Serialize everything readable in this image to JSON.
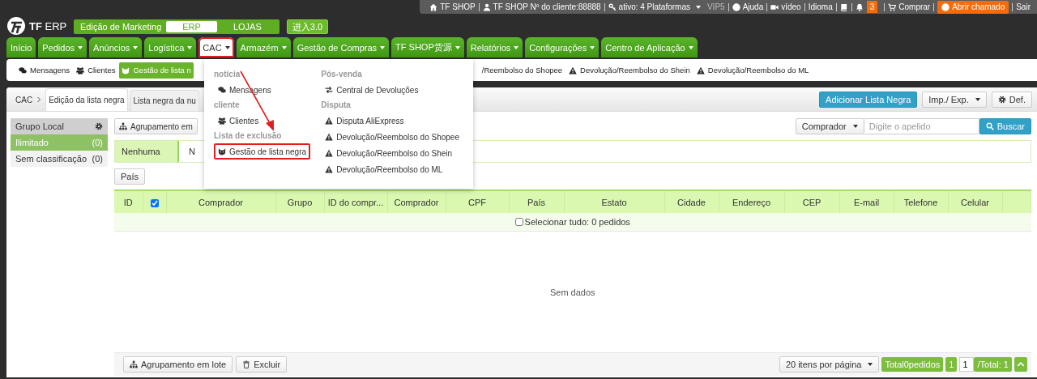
{
  "top_bar": {
    "shop": "TF SHOP",
    "client": "TF SHOP Nº do cliente:88888",
    "platforms": "ativo: 4 Plataformas",
    "vip": "VIP5",
    "help": "Ajuda",
    "video": "vídeo",
    "language": "Idioma",
    "notifications": "3",
    "buy": "Comprar",
    "ticket": "Abrir chamado",
    "logout": "Sair"
  },
  "logo": "**TF** ERP",
  "edition": {
    "label": "Edição de Marketing",
    "options": [
      {
        "label": "ERP",
        "selected": true
      },
      {
        "label": "LOJAS",
        "selected": false
      }
    ]
  },
  "version_button": "进入3.0",
  "nav": [
    {
      "label": "Início",
      "dropdown": false,
      "selected": false,
      "highlighted": false
    },
    {
      "label": "Pedidos",
      "dropdown": true,
      "selected": false,
      "highlighted": false
    },
    {
      "label": "Anúncios",
      "dropdown": true,
      "selected": false,
      "highlighted": false
    },
    {
      "label": "Logística",
      "dropdown": true,
      "selected": false,
      "highlighted": false
    },
    {
      "label": "CAC",
      "dropdown": true,
      "selected": true,
      "highlighted": true
    },
    {
      "label": "Armazém",
      "dropdown": true,
      "selected": false,
      "highlighted": false
    },
    {
      "label": "Gestão de Compras",
      "dropdown": true,
      "selected": false,
      "highlighted": false
    },
    {
      "label": "TF SHOP货源",
      "dropdown": true,
      "selected": false,
      "highlighted": false
    },
    {
      "label": "Relatórios",
      "dropdown": true,
      "selected": false,
      "highlighted": false
    },
    {
      "label": "Configurações",
      "dropdown": true,
      "selected": false,
      "highlighted": false
    },
    {
      "label": "Centro de Aplicação",
      "dropdown": true,
      "selected": false,
      "highlighted": false
    }
  ],
  "submenu": [
    {
      "label": "Mensagens",
      "selected": false
    },
    {
      "label": "Clientes",
      "selected": false
    },
    {
      "label": "Gestão de lista n",
      "selected": true
    },
    {
      "label": "/Reembolso do Shopee",
      "selected": false
    },
    {
      "label": "Devolução/Reembolso do Shein",
      "selected": false
    },
    {
      "label": "Devolução/Reembolso do ML",
      "selected": false
    }
  ],
  "dropdown": {
    "columns": [
      {
        "groups": [
          {
            "title": "notícia",
            "items": [
              {
                "label": "Mensagens",
                "highlighted": false
              }
            ]
          },
          {
            "title": "cliente",
            "items": [
              {
                "label": "Clientes",
                "highlighted": false
              }
            ]
          },
          {
            "title": "Lista de exclusão",
            "items": [
              {
                "label": "Gestão de lista negra",
                "highlighted": true
              }
            ]
          }
        ]
      },
      {
        "groups": [
          {
            "title": "Pós-venda",
            "items": [
              {
                "label": "Central de Devoluções",
                "highlighted": false
              }
            ]
          },
          {
            "title": "Disputa",
            "items": [
              {
                "label": "Disputa AliExpress",
                "highlighted": false
              },
              {
                "label": "Devolução/Reembolso do Shopee",
                "highlighted": false
              },
              {
                "label": "Devolução/Reembolso do Shein",
                "highlighted": false
              },
              {
                "label": "Devolução/Reembolso do ML",
                "highlighted": false
              }
            ]
          }
        ]
      }
    ]
  },
  "breadcrumb": "CAC",
  "tabs": [
    {
      "label": "Edição da lista negra",
      "selected": true
    },
    {
      "label": "Lista negra da nu",
      "selected": false
    }
  ],
  "actions": {
    "add": "Adicionar Lista Negra",
    "import_export": "Imp./ Exp.",
    "settings": "Def."
  },
  "sidebar": {
    "title": "Grupo Local",
    "items": [
      {
        "label": "Ilimitado",
        "count": "(0)",
        "selected": true
      },
      {
        "label": "Sem classificação",
        "count": "(0)",
        "selected": false
      }
    ]
  },
  "toolbar": {
    "group_button": "Agrupamento em",
    "search": {
      "field": "Comprador",
      "placeholder": "Digite o apelido",
      "button": "Buscar"
    }
  },
  "filter": {
    "options": [
      {
        "label": "Nenhuma",
        "selected": true
      },
      {
        "label": "N",
        "selected": false
      }
    ],
    "country_button": "País"
  },
  "table": {
    "columns": [
      {
        "kind": "text",
        "label": "ID"
      },
      {
        "kind": "checkbox",
        "checked": true
      },
      {
        "kind": "text",
        "label": "Comprador"
      },
      {
        "kind": "text",
        "label": "Grupo"
      },
      {
        "kind": "text",
        "label": "ID do compr..."
      },
      {
        "kind": "text",
        "label": "Comprador"
      },
      {
        "kind": "text",
        "label": "CPF"
      },
      {
        "kind": "text",
        "label": "País"
      },
      {
        "kind": "text",
        "label": "Estato"
      },
      {
        "kind": "text",
        "label": "Cidade"
      },
      {
        "kind": "text",
        "label": "Endereço"
      },
      {
        "kind": "text",
        "label": "CEP"
      },
      {
        "kind": "text",
        "label": "E-mail"
      },
      {
        "kind": "text",
        "label": "Telefone"
      },
      {
        "kind": "text",
        "label": "Celular"
      }
    ],
    "select_all": {
      "label": "Selecionar tudo: 0 pedidos",
      "checked": false
    },
    "empty": "Sem dados"
  },
  "footer": {
    "group_button": "Agrupamento em lote",
    "delete_button": "Excluir",
    "page_size": "20 itens por página",
    "total": "Total0pedidos",
    "page": "1",
    "page_input": "1",
    "pages": "/Total: 1"
  }
}
